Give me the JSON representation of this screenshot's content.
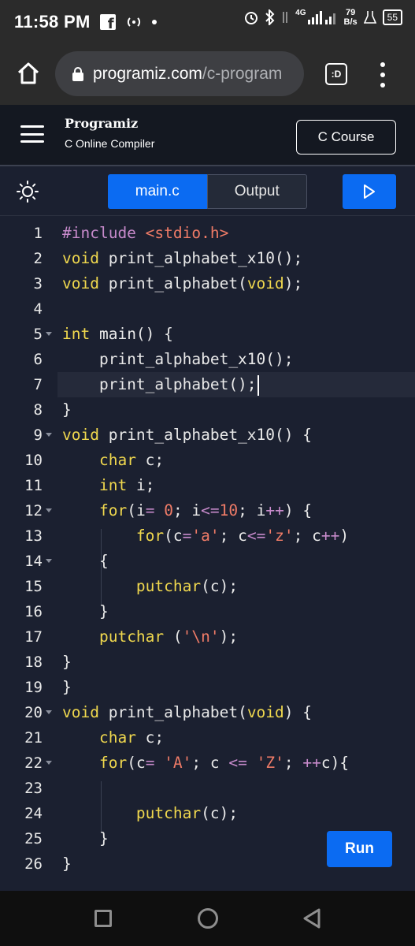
{
  "status_bar": {
    "time": "11:58 PM",
    "network_type": "4G",
    "net_speed_value": "79",
    "net_speed_unit": "B/s",
    "battery": "55",
    "icons": [
      "facebook-icon",
      "hotspot-icon",
      "alarm-icon",
      "bluetooth-icon",
      "data-transfer-icon",
      "signal-icon",
      "lab-icon",
      "battery-icon"
    ]
  },
  "browser": {
    "url_domain": "programiz.com",
    "url_path": "/c-programi",
    "tab_button_label": ":D"
  },
  "site_header": {
    "logo_text": "Programiz",
    "subtitle": "C Online Compiler",
    "course_button": "C Course"
  },
  "toolbar": {
    "tab_main": "main.c",
    "tab_output": "Output"
  },
  "editor": {
    "lines": [
      "#include <stdio.h>",
      "void print_alphabet_x10();",
      "void print_alphabet(void);",
      "",
      "int main() {",
      "    print_alphabet_x10();",
      "    print_alphabet();",
      "}",
      "void print_alphabet_x10() {",
      "    char c;",
      "    int i;",
      "    for(i= 0; i<=10; i++) {",
      "        for(c='a'; c<='z'; c++)",
      "    {",
      "        putchar(c);",
      "    }",
      "    putchar ('\\n');",
      "}",
      "}",
      "void print_alphabet(void) {",
      "    char c;",
      "    for(c= 'A'; c <= 'Z'; ++c){",
      "",
      "        putchar(c);",
      "    }",
      "}"
    ],
    "line_numbers": [
      "1",
      "2",
      "3",
      "4",
      "5",
      "6",
      "7",
      "8",
      "9",
      "10",
      "11",
      "12",
      "13",
      "14",
      "15",
      "16",
      "17",
      "18",
      "19",
      "20",
      "21",
      "22",
      "23",
      "24",
      "25",
      "26"
    ],
    "current_line": 7,
    "fold_lines": [
      5,
      9,
      12,
      14,
      20,
      22
    ]
  },
  "run_button": "Run",
  "colors": {
    "accent": "#0b6bf2",
    "editor_bg": "#1b2030",
    "keyword": "#f0d84e",
    "string": "#ef7b67",
    "preprocessor": "#c78acb"
  }
}
